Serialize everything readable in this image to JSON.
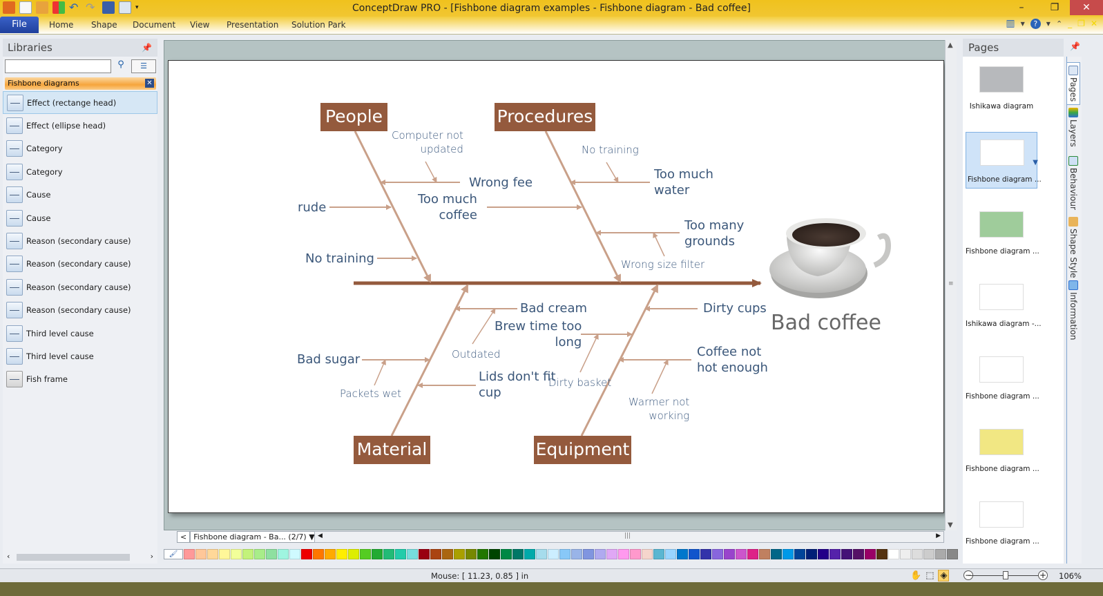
{
  "window": {
    "title": "ConceptDraw PRO - [Fishbone diagram examples - Fishbone diagram - Bad coffee]",
    "controls": {
      "minimize": "–",
      "maximize": "❐",
      "close": "✕"
    }
  },
  "quick_access": [
    "app-icon",
    "new-icon",
    "open-icon",
    "layout-icon",
    "undo-icon",
    "redo-icon",
    "save-icon",
    "print-preview-icon",
    "customize-icon"
  ],
  "ribbon": {
    "file_label": "File",
    "tabs": [
      "Home",
      "Shape",
      "Document",
      "View",
      "Presentation",
      "Solution Park"
    ]
  },
  "libraries": {
    "title": "Libraries",
    "search_placeholder": "",
    "active_library": "Fishbone diagrams",
    "items": [
      {
        "label": "Effect (rectange head)",
        "selected": true
      },
      {
        "label": "Effect (ellipse head)"
      },
      {
        "label": "Category"
      },
      {
        "label": "Category"
      },
      {
        "label": "Cause"
      },
      {
        "label": "Cause"
      },
      {
        "label": "Reason (secondary cause)"
      },
      {
        "label": "Reason (secondary cause)"
      },
      {
        "label": "Reason (secondary cause)"
      },
      {
        "label": "Reason (secondary cause)"
      },
      {
        "label": "Third level cause"
      },
      {
        "label": "Third level cause"
      },
      {
        "label": "Fish frame"
      }
    ]
  },
  "diagram": {
    "effect": "Bad coffee",
    "categories": {
      "people": "People",
      "procedures": "Procedures",
      "material": "Material",
      "equipment": "Equipment"
    },
    "causes": {
      "wrong_fee": "Wrong fee",
      "rude": "rude",
      "no_training": "No training",
      "too_much_coffee": "Too much\ncoffee",
      "too_much_water": "Too much\nwater",
      "too_many_grounds": "Too many\ngrounds",
      "bad_cream": "Bad cream",
      "bad_sugar": "Bad sugar",
      "lids_dont_fit": "Lids don't fit\ncup",
      "brew_time": "Brew time too\nlong",
      "dirty_cups": "Dirty cups",
      "coffee_not_hot": "Coffee not\nhot enough"
    },
    "reasons": {
      "computer_not_updated": "Computer not\nupdated",
      "no_training_proc": "No training",
      "wrong_size_filter": "Wrong size filter",
      "outdated": "Outdated",
      "packets_wet": "Packets wet",
      "dirty_basket": "Dirty basket",
      "warmer_not_working": "Warmer not\nworking"
    },
    "colors": {
      "category_fill": "#945a3d",
      "spine": "#945a3d",
      "bone": "#c9a089",
      "text": "#3b577a"
    }
  },
  "page_nav": {
    "prev": "<",
    "current": "Fishbone diagram - Ba... (2/7)",
    "dropdown": "▼",
    "next": ">"
  },
  "palette": [
    "#ff9999",
    "#ffc799",
    "#ffd899",
    "#fff799",
    "#f2ff99",
    "#c3f27a",
    "#a8ed89",
    "#8ee0a0",
    "#9ff5e0",
    "#cffaff",
    "#ee0000",
    "#ff7700",
    "#ffaa00",
    "#ffee00",
    "#ddee00",
    "#55cc22",
    "#22aa33",
    "#22bb77",
    "#22ccaa",
    "#77dddd",
    "#990011",
    "#aa4411",
    "#aa6611",
    "#aaa000",
    "#778800",
    "#227700",
    "#004400",
    "#008844",
    "#007766",
    "#00aaaa",
    "#a6dcec",
    "#cceeff",
    "#88c8f8",
    "#99b4e8",
    "#8095e0",
    "#b0aaf0",
    "#e0a8f5",
    "#ff99ee",
    "#ff99cc",
    "#f5d5cc",
    "#5ab6d1",
    "#99d5ff",
    "#0077cc",
    "#1155cc",
    "#3333aa",
    "#8866dd",
    "#9944cc",
    "#cc55cc",
    "#dd2288",
    "#c08060",
    "#006688",
    "#0099e8",
    "#004499",
    "#001f77",
    "#220088",
    "#5522aa",
    "#441177",
    "#551166",
    "#990066",
    "#553311",
    "#ffffff",
    "#eeeeee",
    "#dddddd",
    "#cccccc",
    "#aaaaaa",
    "#888888"
  ],
  "status": {
    "mouse": "Mouse: [ 11.23, 0.85 ] in",
    "zoom": "106%",
    "zoom_minus": "−",
    "zoom_plus": "+"
  },
  "pages_panel": {
    "title": "Pages",
    "pages": [
      {
        "label": "Ishikawa diagram",
        "thumb_bg": "#b7b9bc"
      },
      {
        "label": "Fishbone diagram ...",
        "thumb_bg": "#ffffff",
        "selected": true
      },
      {
        "label": "Fishbone diagram ...",
        "thumb_bg": "#9fcc9b"
      },
      {
        "label": "Ishikawa diagram -...",
        "thumb_bg": "#ffffff"
      },
      {
        "label": "Fishbone diagram ...",
        "thumb_bg": "#ffffff"
      },
      {
        "label": "Fishbone diagram ...",
        "thumb_bg": "#f1e783"
      },
      {
        "label": "Fishbone diagram ...",
        "thumb_bg": "#ffffff"
      }
    ],
    "side_tabs": [
      "Pages",
      "Layers",
      "Behaviour",
      "Shape Style",
      "Information"
    ]
  }
}
